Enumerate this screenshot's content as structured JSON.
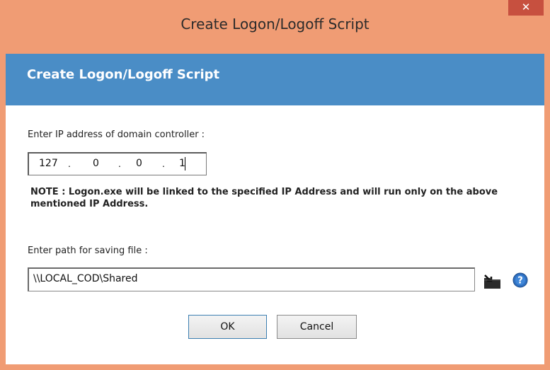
{
  "window": {
    "title": "Create Logon/Logoff Script",
    "close_glyph": "✕"
  },
  "banner": {
    "title": "Create Logon/Logoff Script"
  },
  "ip": {
    "label": "Enter IP address of domain controller  :",
    "octets": [
      "127",
      "0",
      "0",
      "1"
    ],
    "separator": "."
  },
  "note": "NOTE : Logon.exe will be linked to the specified IP Address and will run only on the above mentioned IP Address.",
  "path": {
    "label": "Enter path for saving file   :",
    "value": "\\\\LOCAL_COD\\Shared"
  },
  "buttons": {
    "ok": "OK",
    "cancel": "Cancel"
  },
  "icons": {
    "browse": "folder-browse-icon",
    "help": "help-icon"
  },
  "colors": {
    "titlebar": "#f09c74",
    "banner": "#4a8dc6",
    "close": "#c7503f"
  }
}
